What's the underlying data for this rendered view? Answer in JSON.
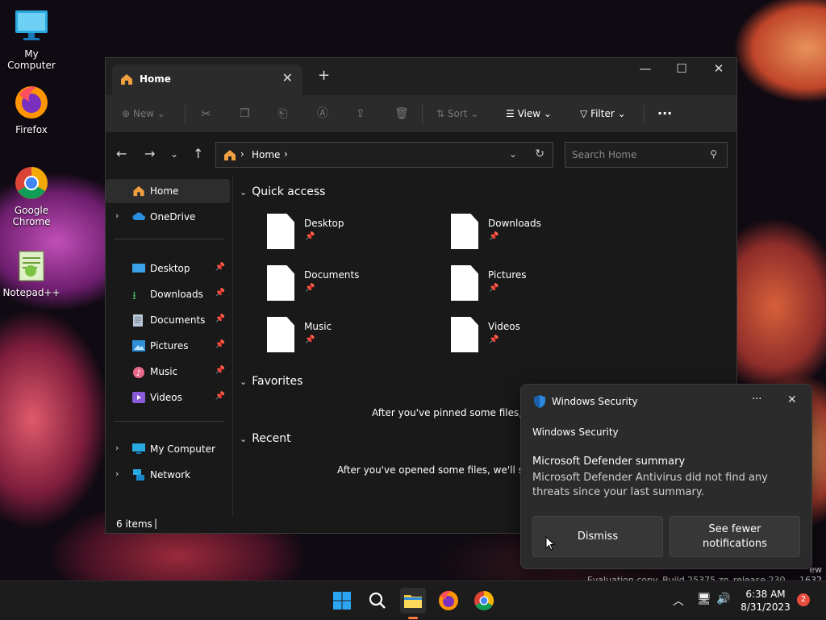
{
  "desktop": {
    "icons": [
      {
        "label": "My Computer"
      },
      {
        "label": "Firefox"
      },
      {
        "label": "Google Chrome"
      },
      {
        "label": "Notepad++"
      }
    ]
  },
  "explorer": {
    "tab_title": "Home",
    "new_tab_symbol": "+",
    "commands": {
      "new": "New",
      "sort": "Sort",
      "view": "View",
      "filter": "Filter",
      "more": "···"
    },
    "address": {
      "path": "Home",
      "search_placeholder": "Search Home"
    },
    "sidebar": {
      "home": "Home",
      "onedrive": "OneDrive",
      "pinned": [
        "Desktop",
        "Downloads",
        "Documents",
        "Pictures",
        "Music",
        "Videos"
      ],
      "my_computer": "My Computer",
      "network": "Network"
    },
    "quick_access": {
      "title": "Quick access",
      "items": [
        "Desktop",
        "Downloads",
        "Documents",
        "Pictures",
        "Music",
        "Videos"
      ]
    },
    "favorites": {
      "title": "Favorites",
      "empty_text": "After you've pinned some files, we'"
    },
    "recent": {
      "title": "Recent",
      "empty_text": "After you've opened some files, we'll show"
    },
    "status": "6 items"
  },
  "toast": {
    "app_name": "Windows Security",
    "header": "Windows Security",
    "title": "Microsoft Defender summary",
    "body": "Microsoft Defender Antivirus did not find any threats since your last summary.",
    "dismiss": "Dismiss",
    "fewer": "See fewer notifications",
    "more": "···"
  },
  "watermark": {
    "line1": "ew",
    "line2": "Evaluation copy. Build 25375.zn_release.230 ... 1632"
  },
  "taskbar": {
    "time": "6:38 AM",
    "date": "8/31/2023",
    "notification_count": "2"
  },
  "colors": {
    "accent": "#0078d4",
    "window_bg": "#191919",
    "badge": "#e74c3c"
  }
}
